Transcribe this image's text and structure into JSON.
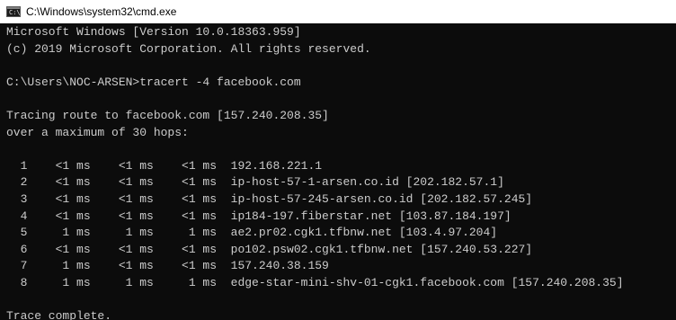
{
  "window": {
    "title": "C:\\Windows\\system32\\cmd.exe",
    "icon": "cmd-icon",
    "icon_glyph": "C:\\"
  },
  "console": {
    "lines": [
      "Microsoft Windows [Version 10.0.18363.959]",
      "(c) 2019 Microsoft Corporation. All rights reserved.",
      "",
      "C:\\Users\\NOC-ARSEN>tracert -4 facebook.com",
      "",
      "Tracing route to facebook.com [157.240.208.35]",
      "over a maximum of 30 hops:",
      "",
      "  1    <1 ms    <1 ms    <1 ms  192.168.221.1",
      "  2    <1 ms    <1 ms    <1 ms  ip-host-57-1-arsen.co.id [202.182.57.1]",
      "  3    <1 ms    <1 ms    <1 ms  ip-host-57-245-arsen.co.id [202.182.57.245]",
      "  4    <1 ms    <1 ms    <1 ms  ip184-197.fiberstar.net [103.87.184.197]",
      "  5     1 ms     1 ms     1 ms  ae2.pr02.cgk1.tfbnw.net [103.4.97.204]",
      "  6    <1 ms    <1 ms    <1 ms  po102.psw02.cgk1.tfbnw.net [157.240.53.227]",
      "  7     1 ms    <1 ms    <1 ms  157.240.38.159",
      "  8     1 ms     1 ms     1 ms  edge-star-mini-shv-01-cgk1.facebook.com [157.240.208.35]",
      "",
      "Trace complete."
    ]
  },
  "colors": {
    "background": "#0c0c0c",
    "text": "#cccccc",
    "titlebar": "#ffffff"
  }
}
